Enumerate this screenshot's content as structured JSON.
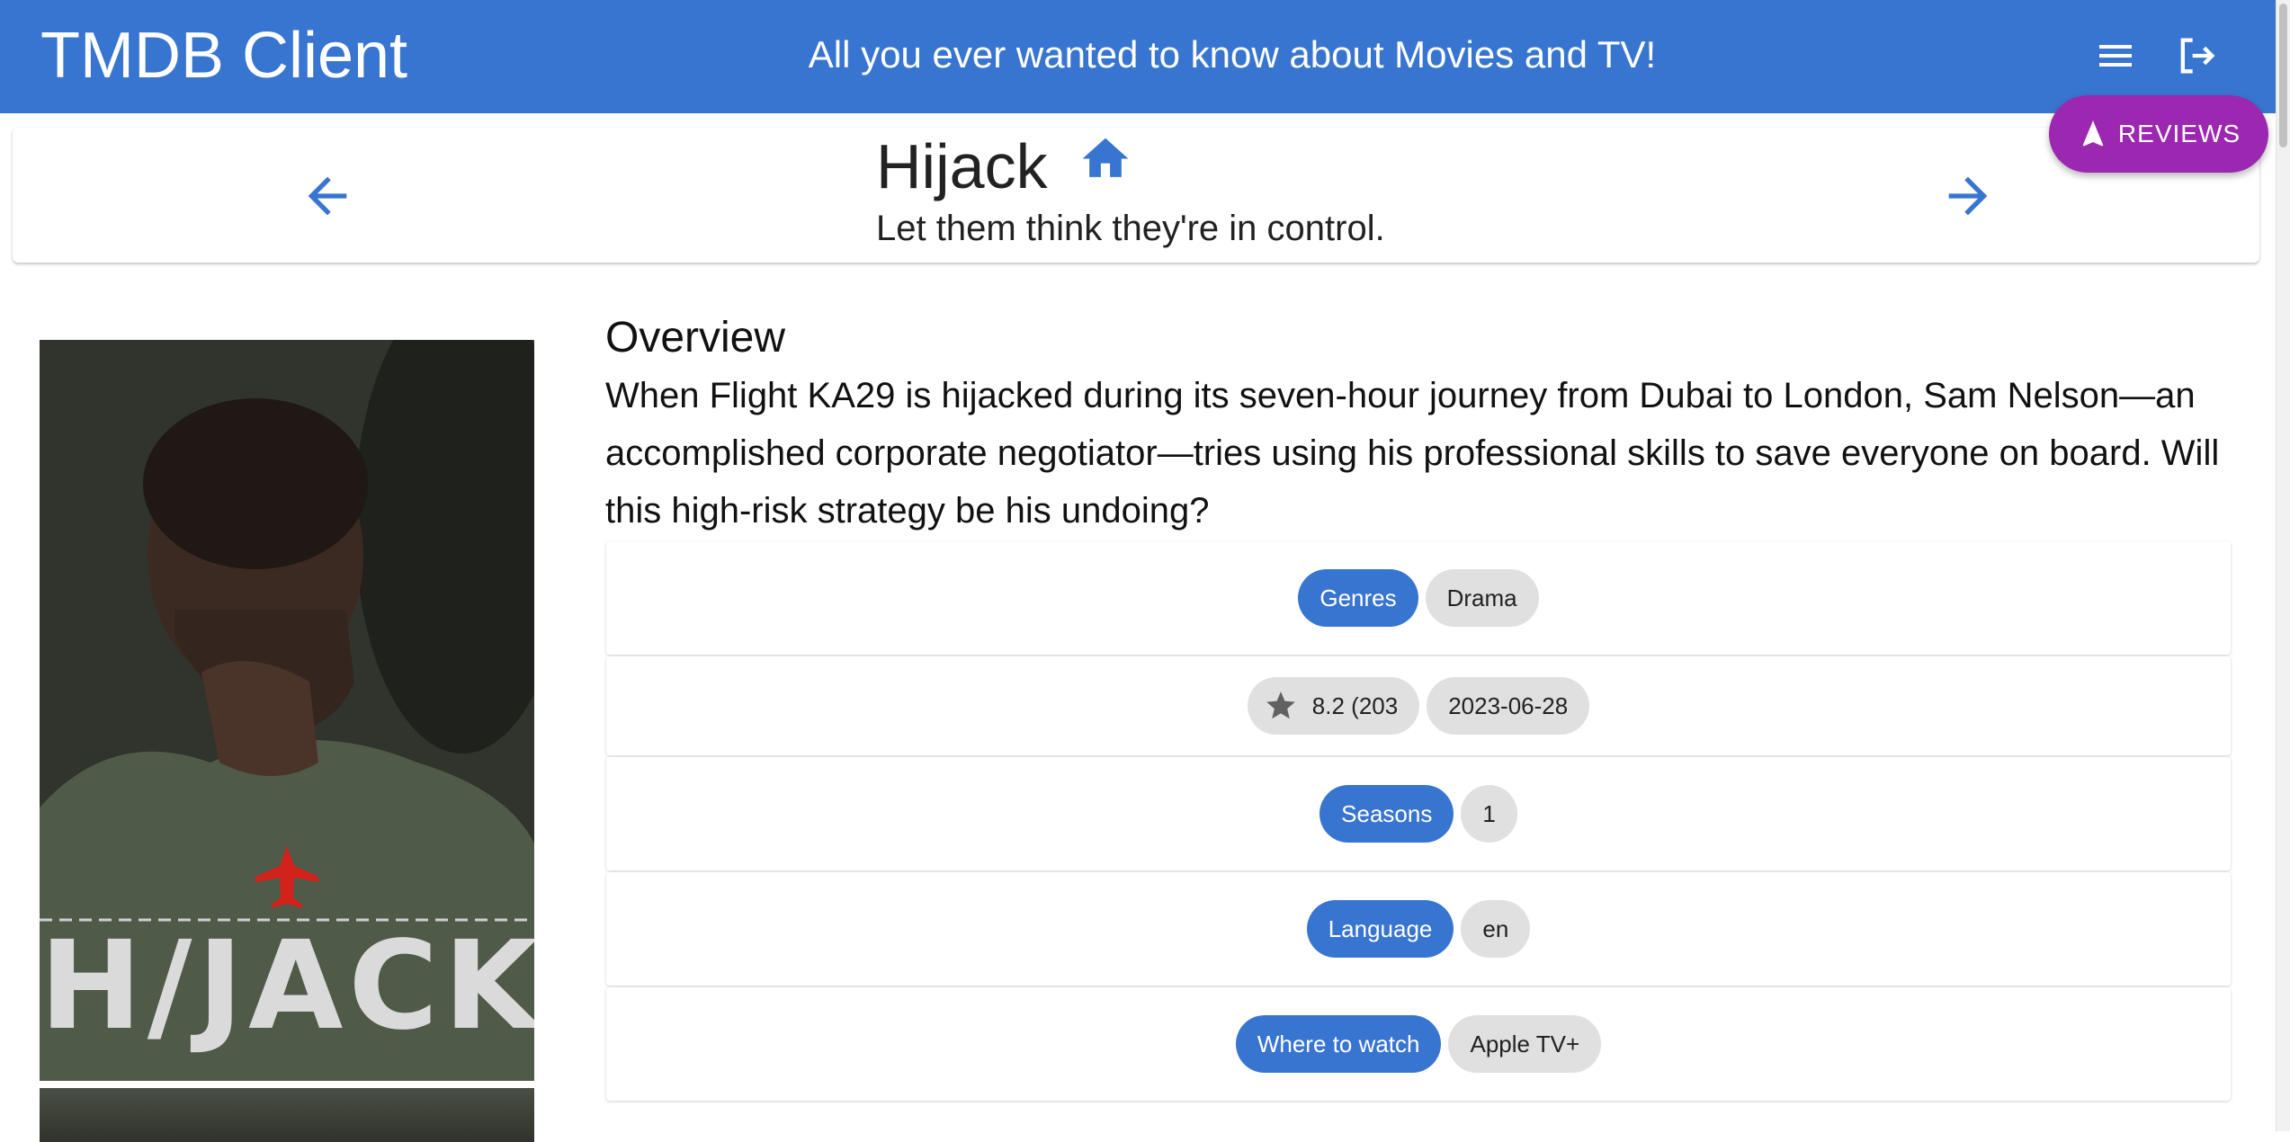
{
  "app": {
    "title": "TMDB Client",
    "tagline": "All you ever wanted to know about Movies and TV!",
    "colors": {
      "primary": "#3875d0",
      "reviews": "#9c27b0",
      "chip_default": "#e0e0e0"
    },
    "icons": {
      "menu": "menu-icon",
      "logout": "logout-icon"
    }
  },
  "header": {
    "title": "Hijack",
    "tagline": "Let them think they're in control.",
    "icons": {
      "home": "home-icon",
      "prev": "arrow-left-icon",
      "next": "arrow-right-icon"
    }
  },
  "reviews_button": {
    "label": "REVIEWS",
    "icon": "navigation-icon"
  },
  "poster": {
    "title_text": "H/JACK"
  },
  "overview": {
    "heading": "Overview",
    "text": "When Flight KA29 is hijacked during its seven-hour journey from Dubai to London, Sam Nelson—an accomplished corporate negotiator—tries using his professional skills to save everyone on board. Will this high-risk strategy be his undoing?"
  },
  "details": {
    "genres_label": "Genres",
    "genres": [
      "Drama"
    ],
    "rating": "8.2 (203",
    "rating_icon": "star-icon",
    "first_air_date": "2023-06-28",
    "seasons_label": "Seasons",
    "seasons": "1",
    "language_label": "Language",
    "language": "en",
    "watch_label": "Where to watch",
    "watch_provider": "Apple TV+"
  }
}
